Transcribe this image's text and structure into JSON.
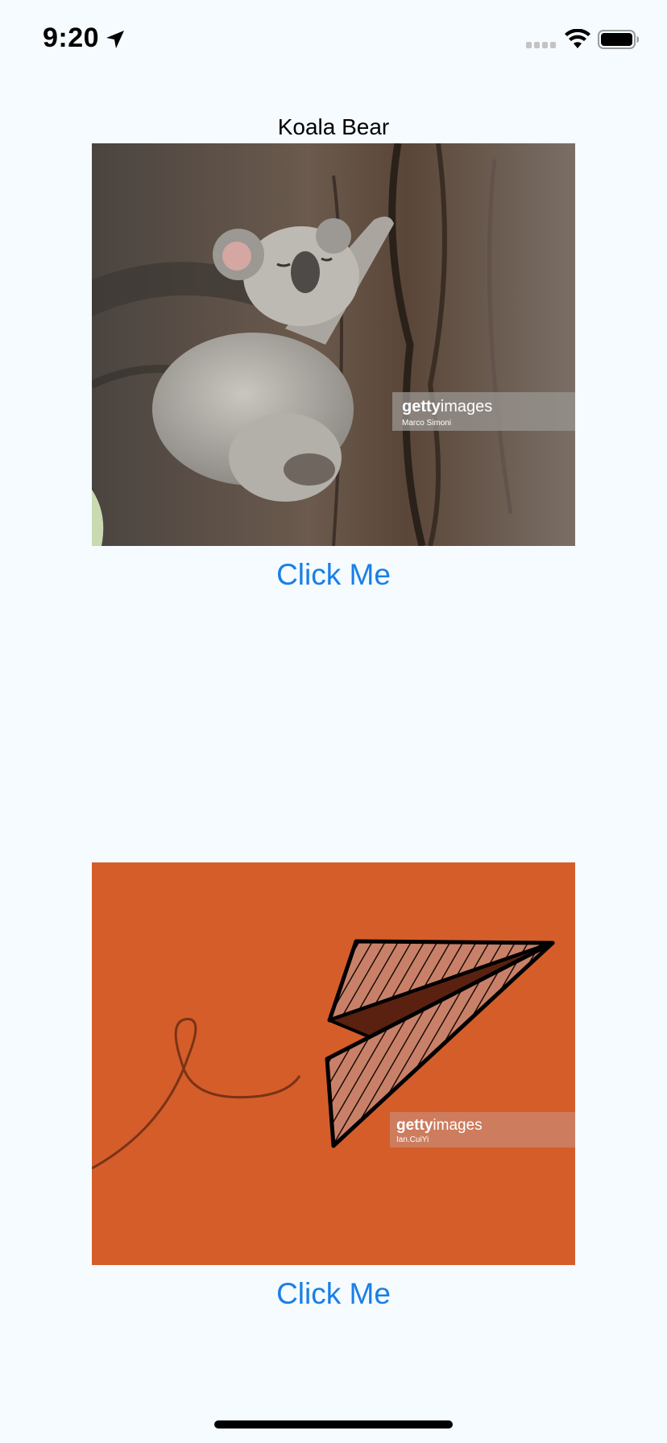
{
  "status_bar": {
    "time": "9:20",
    "icons": [
      "location-arrow-icon",
      "cellular-signal-icon",
      "wifi-icon",
      "battery-icon"
    ]
  },
  "content": {
    "caption": "Koala Bear",
    "items": [
      {
        "image": "koala-photo",
        "watermark": {
          "brand_bold": "getty",
          "brand_light": "images",
          "credit": "Marco Simoni"
        },
        "button_label": "Click Me"
      },
      {
        "image": "paper-plane-illustration",
        "watermark": {
          "brand_bold": "getty",
          "brand_light": "images",
          "credit": "Ian.CuiYi"
        },
        "button_label": "Click Me"
      }
    ]
  },
  "colors": {
    "background": "#f5fbfe",
    "link": "#1a7fe6",
    "plane_background": "#d55d2a"
  }
}
